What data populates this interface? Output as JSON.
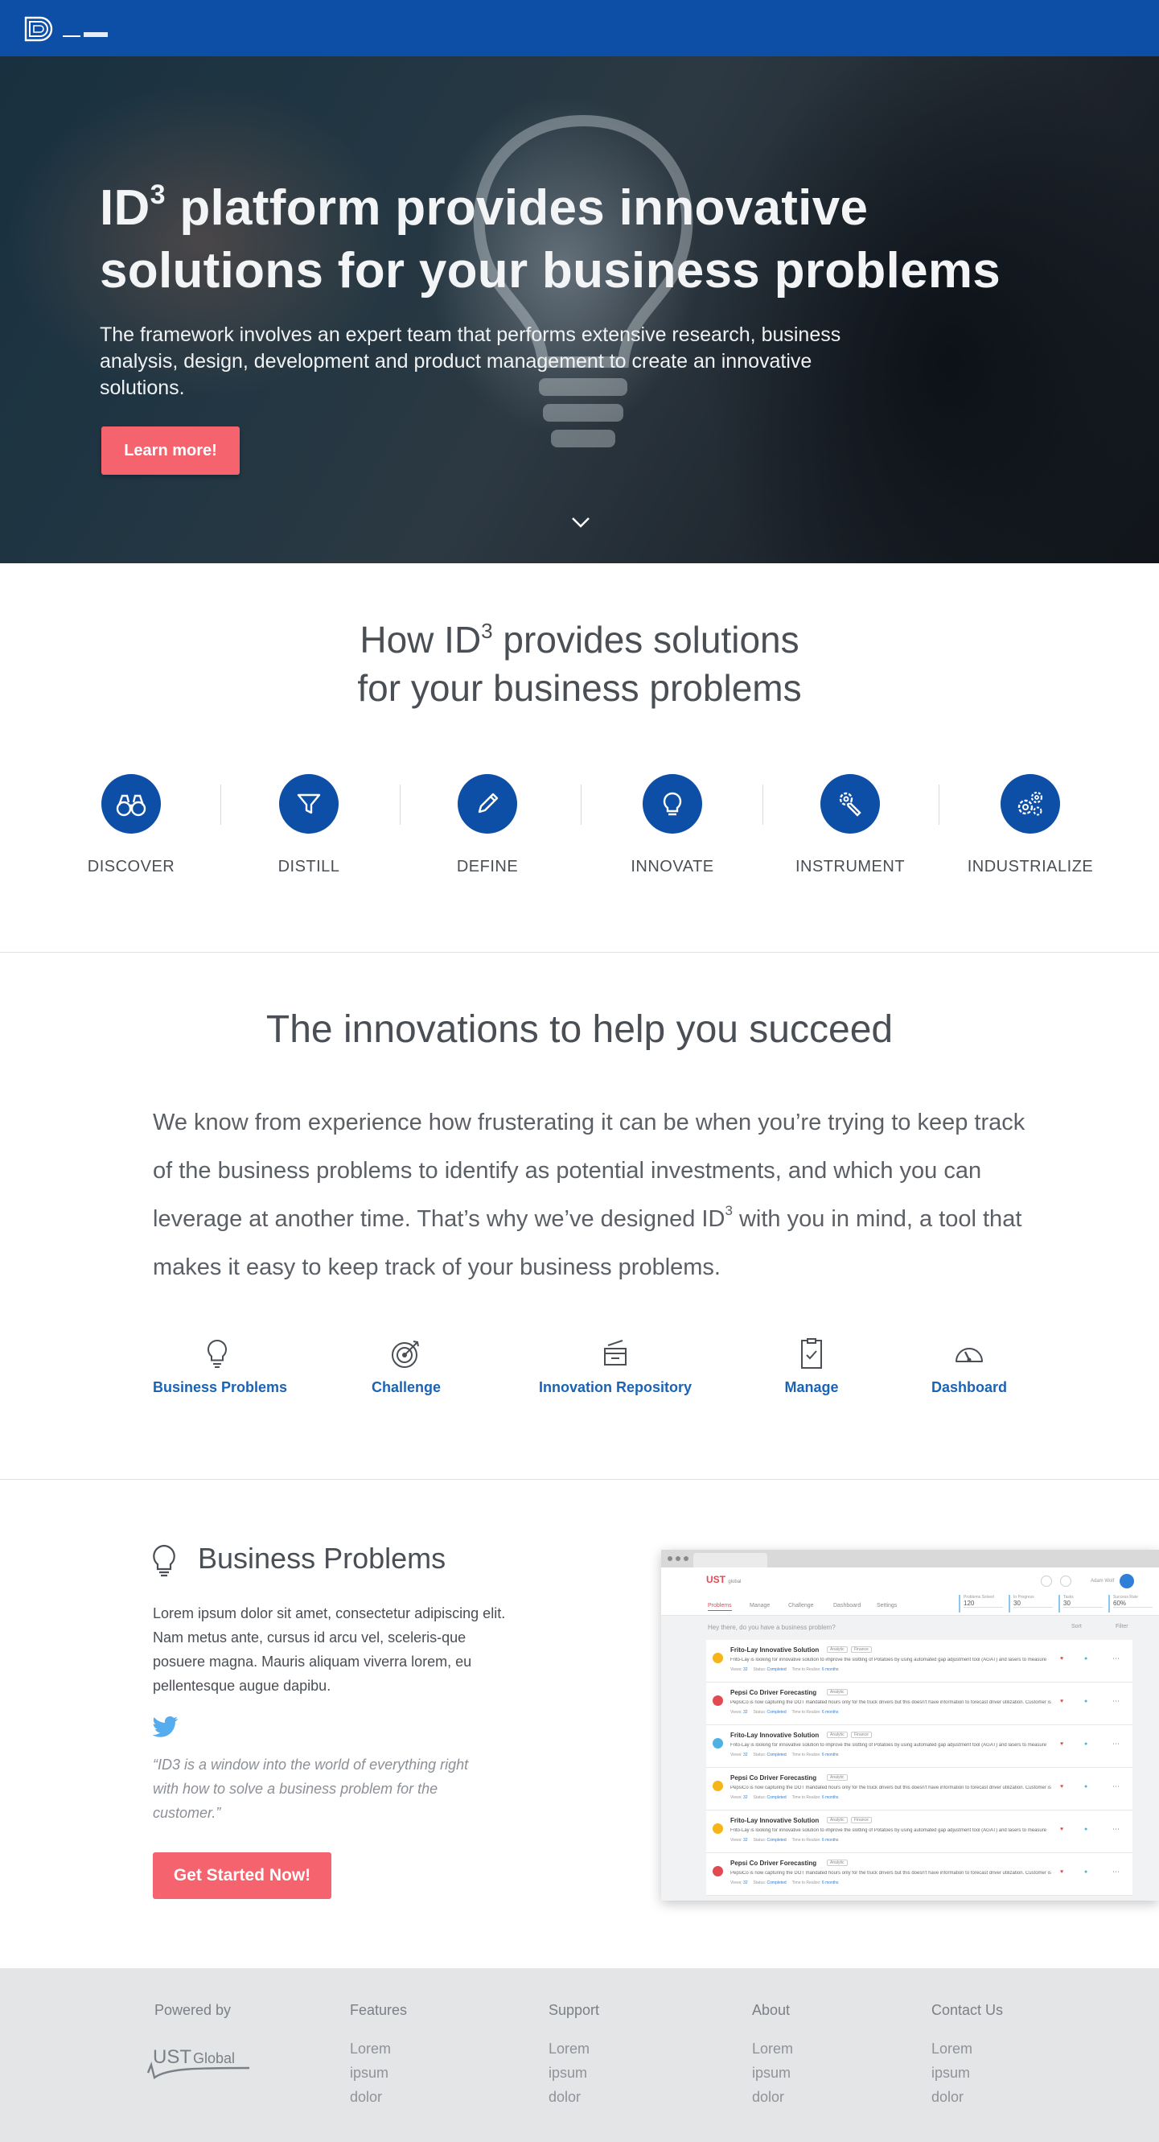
{
  "hero": {
    "title_a": "ID",
    "title_sup": "3",
    "title_b": " platform provides innovative",
    "title_line2": "solutions for your business problems",
    "subtitle": "The framework involves an expert team that performs extensive research, business analysis, design, development and product management to create an innovative solutions.",
    "cta": "Learn more!"
  },
  "how": {
    "title_a": "How ID",
    "title_sup": "3",
    "title_b": " provides solutions",
    "title_line2": "for your business problems",
    "steps": [
      {
        "label": "DISCOVER",
        "icon": "binoculars-icon"
      },
      {
        "label": "DISTILL",
        "icon": "filter-icon"
      },
      {
        "label": "DEFINE",
        "icon": "pencil-icon"
      },
      {
        "label": "INNOVATE",
        "icon": "lightbulb-icon"
      },
      {
        "label": "INSTRUMENT",
        "icon": "wrench-gear-icon"
      },
      {
        "label": "INDUSTRIALIZE",
        "icon": "gears-icon"
      }
    ]
  },
  "innovations": {
    "title": "The innovations to help you succeed",
    "body_a": "We know from experience how frusterating it can be when you’re trying to keep track of the business problems to identify as potential investments, and which you can leverage at another time. That’s why we’ve designed ID",
    "body_sup": "3",
    "body_b": " with you in mind, a tool that makes it easy to keep track of your business problems.",
    "features": [
      {
        "label": "Business Problems",
        "icon": "lightbulb-icon"
      },
      {
        "label": "Challenge",
        "icon": "target-icon"
      },
      {
        "label": "Innovation Repository",
        "icon": "archive-icon"
      },
      {
        "label": "Manage",
        "icon": "clipboard-check-icon"
      },
      {
        "label": "Dashboard",
        "icon": "gauge-icon"
      }
    ]
  },
  "business": {
    "title": "Business Problems",
    "body": "Lorem ipsum dolor sit amet, consectetur adipiscing elit. Nam metus ante, cursus id arcu vel, sceleris-que posuere magna. Mauris aliquam viverra lorem, eu pellentesque augue dapibu.",
    "quote": "“ID3 is a window into the world of everything right with how to solve a business problem for the customer.”",
    "cta": "Get Started Now!"
  },
  "mockup": {
    "logo": "UST",
    "logo_sub": "global",
    "user": "Adam Wolf",
    "nav": [
      "Problems",
      "Manage",
      "Challenge",
      "Dashboard",
      "Settings"
    ],
    "stats": [
      {
        "label": "Problems Solved",
        "value": "120"
      },
      {
        "label": "In Progress",
        "value": "30"
      },
      {
        "label": "Tasks",
        "value": "30"
      },
      {
        "label": "Success Rate",
        "value": "60%"
      }
    ],
    "prompt": "Hey there, do you have a business problem?",
    "sort": "Sort",
    "filter": "Filter",
    "rows": [
      {
        "title": "Frito-Lay Innovative Solution",
        "tags": [
          "Analytic",
          "Finance"
        ],
        "desc": "Frito-Lay is looking for innovative solution to improve the slotting of Potatoes by using automated gap adjustment tool (AGAT) and lasers to measure",
        "meta_a": "Views",
        "meta_b": "Status",
        "status": "Completed",
        "meta_c": "Time to Realize",
        "months": "6 months",
        "views": "32",
        "color": "#f5b417"
      },
      {
        "title": "Pepsi Co Driver Forecasting",
        "tags": [
          "Analytic"
        ],
        "desc": "PepsiCo is now capturing the DOT mandated hours only for the truck drivers but this doesn't have information to forecast driver utilization. Customer is",
        "meta_a": "Views",
        "meta_b": "Status",
        "status": "Completed",
        "meta_c": "Time to Realize",
        "months": "6 months",
        "views": "32",
        "color": "#e24a53"
      },
      {
        "title": "Frito-Lay Innovative Solution",
        "tags": [
          "Analytic",
          "Finance"
        ],
        "desc": "Frito-Lay is looking for innovative solution to improve the slotting of Potatoes by using automated gap adjustment tool (AGAT) and lasers to measure",
        "meta_a": "Views",
        "meta_b": "Status",
        "status": "Completed",
        "meta_c": "Time to Realize",
        "months": "6 months",
        "views": "32",
        "color": "#4fb1e3"
      },
      {
        "title": "Pepsi Co Driver Forecasting",
        "tags": [
          "Analytic"
        ],
        "desc": "PepsiCo is now capturing the DOT mandated hours only for the truck drivers but this doesn't have information to forecast driver utilization. Customer is",
        "meta_a": "Views",
        "meta_b": "Status",
        "status": "Completed",
        "meta_c": "Time to Realize",
        "months": "6 months",
        "views": "32",
        "color": "#f5b417"
      },
      {
        "title": "Frito-Lay Innovative Solution",
        "tags": [
          "Analytic",
          "Finance"
        ],
        "desc": "Frito-Lay is looking for innovative solution to improve the slotting of Potatoes by using automated gap adjustment tool (AGAT) and lasers to measure",
        "meta_a": "Views",
        "meta_b": "Status",
        "status": "Completed",
        "meta_c": "Time to Realize",
        "months": "6 months",
        "views": "32",
        "color": "#f5b417"
      },
      {
        "title": "Pepsi Co Driver Forecasting",
        "tags": [
          "Analytic"
        ],
        "desc": "PepsiCo is now capturing the DOT mandated hours only for the truck drivers but this doesn't have information to forecast driver utilization. Customer is",
        "meta_a": "Views",
        "meta_b": "Status",
        "status": "Completed",
        "meta_c": "Time to Realize",
        "months": "6 months",
        "views": "32",
        "color": "#e24a53"
      }
    ]
  },
  "footer": {
    "powered": "Powered by",
    "ust_a": "UST",
    "ust_b": "Global",
    "columns": [
      {
        "title": "Features",
        "links": [
          "Lorem",
          "ipsum",
          "dolor"
        ]
      },
      {
        "title": "Support",
        "links": [
          "Lorem",
          "ipsum",
          "dolor"
        ]
      },
      {
        "title": "About",
        "links": [
          "Lorem",
          "ipsum",
          "dolor"
        ]
      },
      {
        "title": "Contact Us",
        "links": [
          "Lorem",
          "ipsum",
          "dolor"
        ]
      }
    ]
  },
  "colors": {
    "brand_blue": "#0d4ea6",
    "cta_red": "#f5646e",
    "link_blue": "#1b63b4"
  }
}
